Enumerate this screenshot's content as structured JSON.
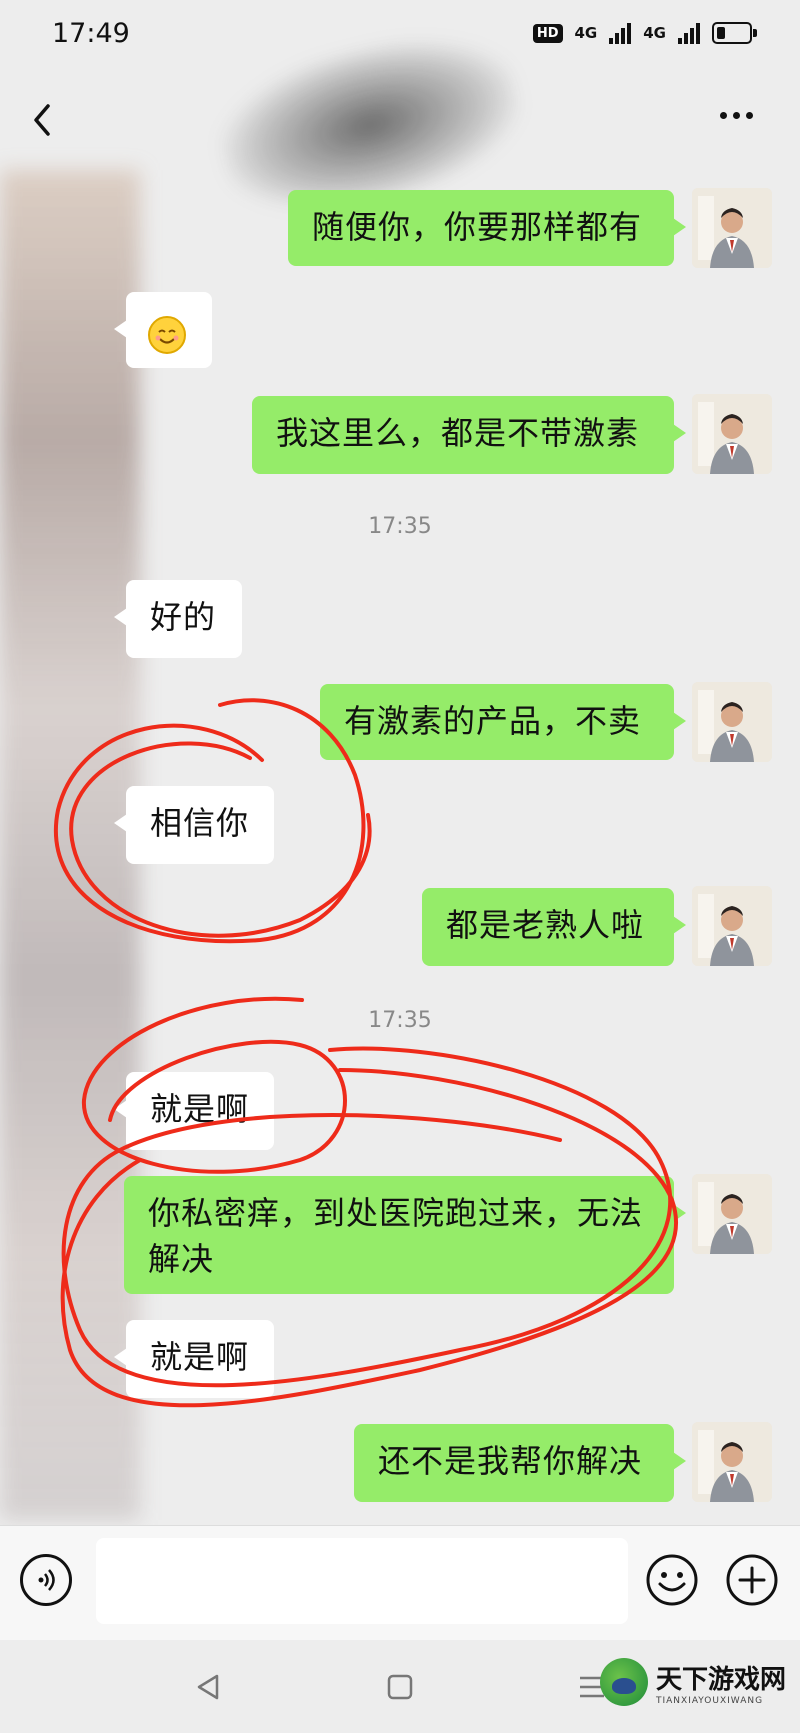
{
  "status_bar": {
    "time": "17:49",
    "hd_label": "HD",
    "net1": "4G",
    "net2": "4G",
    "battery_level": 0.25
  },
  "messages": [
    {
      "side": "out",
      "text": "随便你，你要那样都有",
      "avatar": "user-avatar"
    },
    {
      "side": "in",
      "text": "",
      "emoji": "smiling-face-emoji"
    },
    {
      "side": "out",
      "text": "我这里么，都是不带激素",
      "avatar": "user-avatar"
    },
    {
      "type": "time",
      "text": "17:35"
    },
    {
      "side": "in",
      "text": "好的"
    },
    {
      "side": "out",
      "text": "有激素的产品，不卖",
      "avatar": "user-avatar"
    },
    {
      "side": "in",
      "text": "相信你"
    },
    {
      "side": "out",
      "text": "都是老熟人啦",
      "avatar": "user-avatar"
    },
    {
      "type": "time",
      "text": "17:35"
    },
    {
      "side": "in",
      "text": "就是啊"
    },
    {
      "side": "out",
      "text": "你私密痒，到处医院跑过来，无法解决",
      "avatar": "user-avatar"
    },
    {
      "side": "in",
      "text": "就是啊"
    },
    {
      "side": "out",
      "text": "还不是我帮你解决",
      "avatar": "user-avatar"
    }
  ],
  "input_bar": {
    "voice_icon": "voice-icon",
    "emoji_icon": "emoji-icon",
    "plus_icon": "plus-icon",
    "input_value": ""
  },
  "watermark": {
    "brand_cn": "天下游戏网",
    "brand_en": "TIANXIAYOUXIWANG"
  },
  "colors": {
    "outgoing_bubble": "#95ec69",
    "incoming_bubble": "#ffffff",
    "background": "#ededed",
    "annotation_red": "#ee2b1a"
  }
}
